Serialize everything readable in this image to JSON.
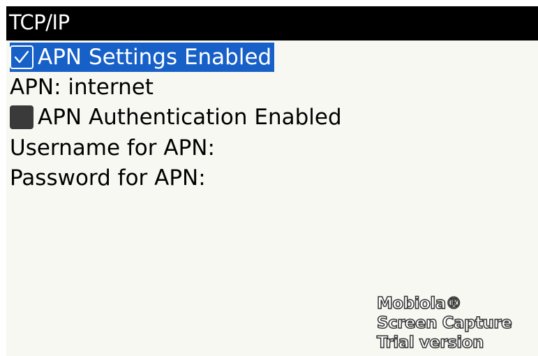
{
  "titlebar": {
    "title": "TCP/IP"
  },
  "options": {
    "apn_settings": {
      "label": "APN Settings Enabled",
      "checked": true
    },
    "apn": {
      "label": "APN: internet"
    },
    "apn_auth": {
      "label": "APN Authentication Enabled",
      "checked": false
    },
    "username": {
      "label": "Username for APN:"
    },
    "password": {
      "label": "Password for APN:"
    }
  },
  "watermark": {
    "line1": "Mobiola®",
    "line2": "Screen Capture",
    "line3": "Trial version"
  },
  "colors": {
    "selection": "#1760c7",
    "background": "#f7f8f2",
    "titlebar": "#000000"
  },
  "icons": {
    "checked": "checkbox-checked-icon",
    "unchecked": "checkbox-unchecked-icon"
  }
}
